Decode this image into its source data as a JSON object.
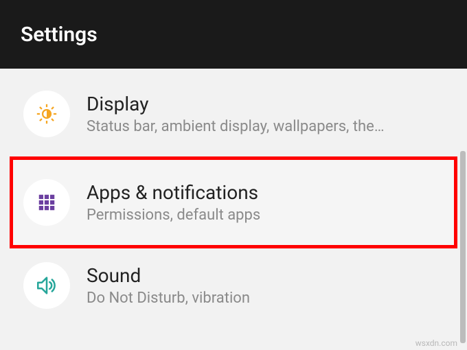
{
  "header": {
    "title": "Settings"
  },
  "items": [
    {
      "icon": "brightness-icon",
      "title": "Display",
      "subtitle": "Status bar, ambient display, wallpapers, the…",
      "highlighted": false
    },
    {
      "icon": "apps-grid-icon",
      "title": "Apps & notifications",
      "subtitle": "Permissions, default apps",
      "highlighted": true
    },
    {
      "icon": "sound-icon",
      "title": "Sound",
      "subtitle": "Do Not Disturb, vibration",
      "highlighted": false
    }
  ],
  "colors": {
    "brightness": "#f5a623",
    "apps": "#6b3fa0",
    "sound": "#26a69a",
    "highlight_border": "#ff0000"
  },
  "watermark": "wsxdn.com"
}
